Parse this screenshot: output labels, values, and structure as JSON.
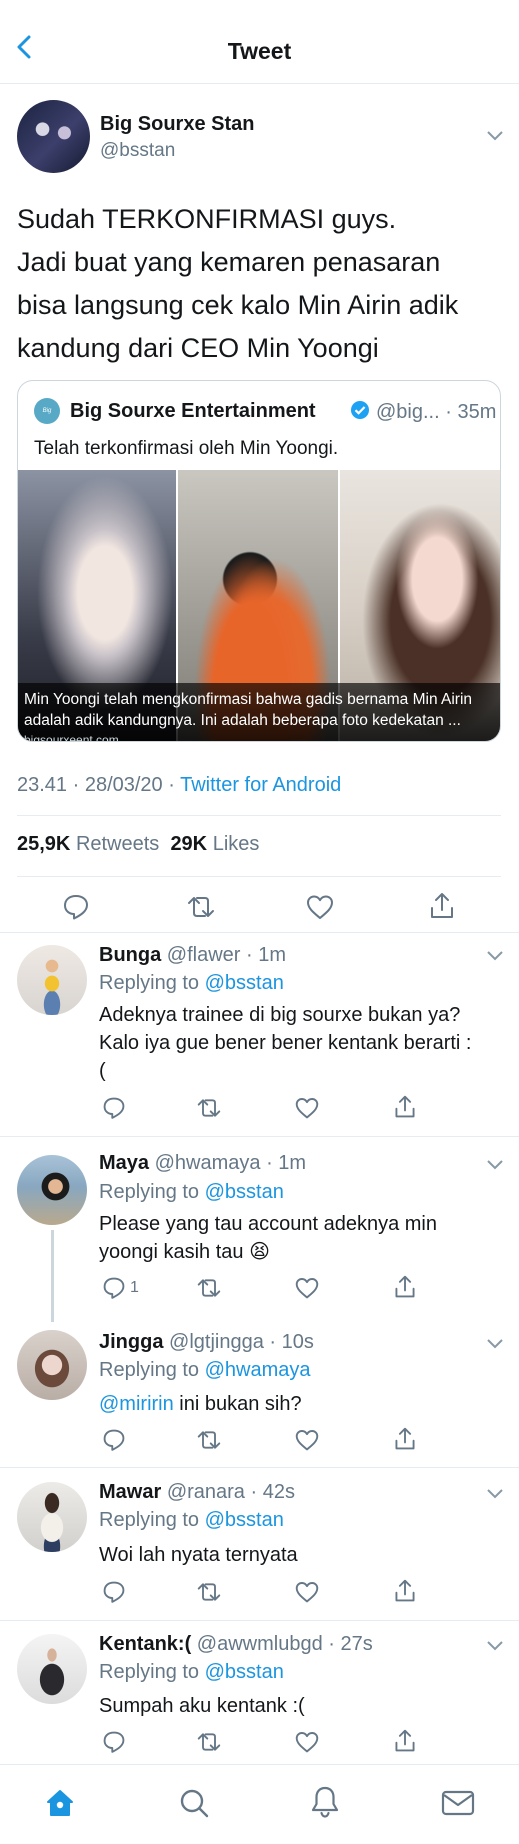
{
  "header": {
    "title": "Tweet"
  },
  "tweet": {
    "name": "Big Sourxe Stan",
    "handle": "@bsstan",
    "text_lines": [
      "Sudah TERKONFIRMASI guys.",
      "Jadi buat yang kemaren penasaran",
      "bisa langsung cek kalo Min Airin adik",
      "kandung dari CEO Min Yoongi"
    ],
    "quote": {
      "avatar_text": "Big Sourxe",
      "name": "Big Sourxe Entertainment",
      "handle": "@big...",
      "time": "· 35m",
      "text": "Telah terkonfirmasi oleh Min Yoongi.",
      "caption_lines": [
        "Min Yoongi telah mengkonfirmasi bahwa gadis bernama Min Airin",
        "adalah adik kandungnya. Ini adalah beberapa foto kedekatan ..."
      ],
      "domain": "bigsourxeent.com"
    },
    "timestamp": "23.41 · 28/03/20 ·",
    "source": "Twitter for Android",
    "retweets_count": "25,9K",
    "retweets_label": "Retweets",
    "likes_count": "29K",
    "likes_label": "Likes"
  },
  "replies": [
    {
      "name": "Bunga",
      "handle": "@flawer",
      "time": "· 1m",
      "replying_label": "Replying to",
      "replying_to": "@bsstan",
      "text_lines": [
        "Adeknya trainee di big sourxe bukan ya?",
        "Kalo iya gue bener bener kentank berarti :",
        "("
      ]
    },
    {
      "name": "Maya",
      "handle": "@hwamaya",
      "time": "· 1m",
      "replying_label": "Replying to",
      "replying_to": "@bsstan",
      "text_lines": [
        "Please yang tau account adeknya min",
        "yoongi kasih tau 😫"
      ],
      "reply_count": "1"
    },
    {
      "name": "Jingga",
      "handle": "@lgtjingga",
      "time": "· 10s",
      "replying_label": "Replying to",
      "replying_to": "@hwamaya",
      "mention": "@miririn",
      "text": " ini bukan sih?"
    },
    {
      "name": "Mawar",
      "handle": "@ranara",
      "time": "· 42s",
      "replying_label": "Replying to",
      "replying_to": "@bsstan",
      "text": "Woi lah nyata ternyata"
    },
    {
      "name": "Kentank:(",
      "handle": "@awwmlubgd",
      "time": "· 27s",
      "replying_label": "Replying to",
      "replying_to": "@bsstan",
      "text": "Sumpah aku kentank :("
    }
  ],
  "icons": {
    "back": "back-arrow-icon",
    "chevron": "chevron-down-icon",
    "verified": "verified-badge-icon",
    "reply": "reply-icon",
    "retweet": "retweet-icon",
    "like": "heart-icon",
    "share": "share-icon",
    "home": "home-icon",
    "search": "search-icon",
    "notifications": "bell-icon",
    "messages": "mail-icon"
  },
  "colors": {
    "accent": "#1b95e0",
    "secondary_text": "#657786",
    "divider": "#e6ecf0"
  }
}
